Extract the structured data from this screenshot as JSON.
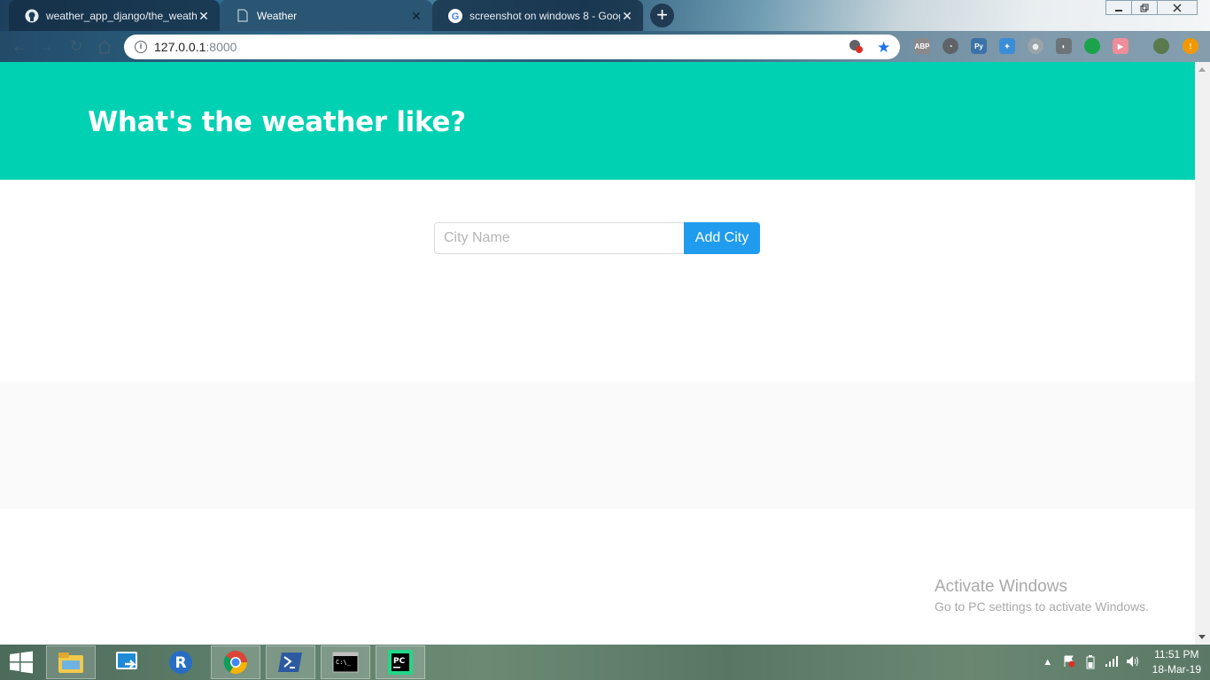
{
  "browser": {
    "tabs": [
      {
        "title": "weather_app_django/the_weathe",
        "icon": "github-icon",
        "active": false
      },
      {
        "title": "Weather",
        "icon": "document-icon",
        "active": true
      },
      {
        "title": "screenshot on windows 8 - Goog",
        "icon": "google-icon",
        "active": false
      }
    ],
    "new_tab_label": "+",
    "address": {
      "host": "127.0.0.1",
      "port": ":8000"
    }
  },
  "page": {
    "hero_title": "What's the weather like?",
    "form": {
      "city_placeholder": "City Name",
      "add_button_label": "Add City"
    }
  },
  "watermark": {
    "line1": "Activate Windows",
    "line2": "Go to PC settings to activate Windows."
  },
  "taskbar": {
    "apps": [
      "file-explorer-icon",
      "remote-app-icon",
      "r-icon",
      "chrome-icon",
      "powershell-icon",
      "cmd-icon",
      "pycharm-icon"
    ],
    "clock": {
      "time": "11:51 PM",
      "date": "18-Mar-19"
    }
  },
  "colors": {
    "hero": "#00d1b2",
    "button": "#209cee",
    "band": "#fafafa"
  }
}
